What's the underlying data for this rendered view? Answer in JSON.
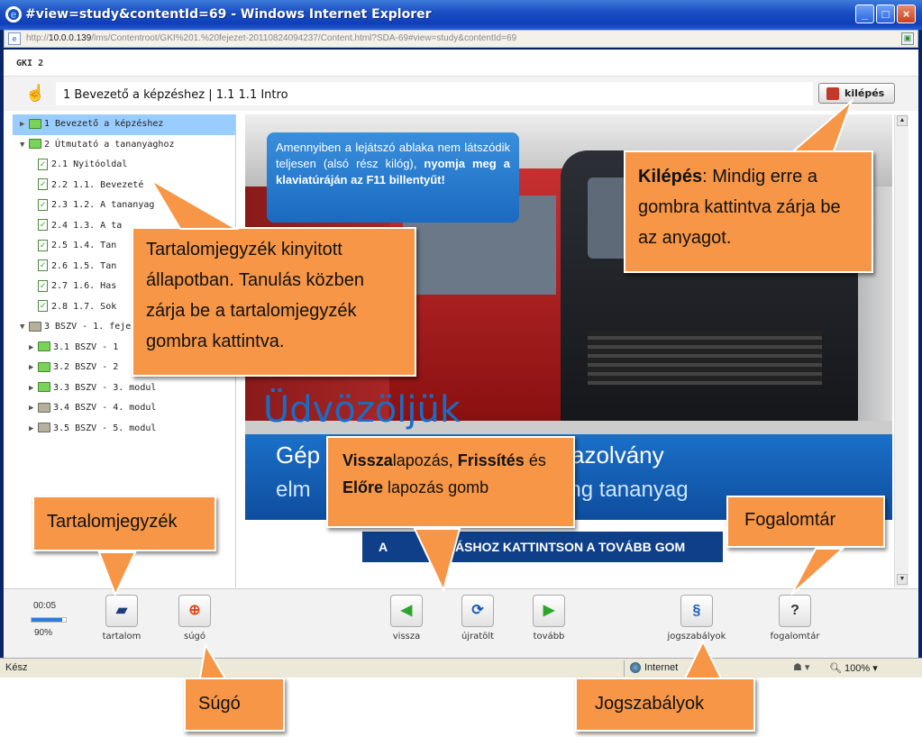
{
  "window": {
    "title": "#view=study&contentId=69 - Windows Internet Explorer",
    "url_prefix": "http://",
    "url_host": "10.0.0.139",
    "url_path": "/lms/Contentroot/GKI%201.%20fejezet-20110824094237/Content.html?SDA-69#view=study&contentId=69"
  },
  "app": {
    "name": "GKI 2",
    "breadcrumb": "1 Bevezető a képzéshez | 1.1 1.1 Intro",
    "exit_label": "kilépés"
  },
  "toc": [
    {
      "label": "1 Bevezető a képzéshez",
      "arrow": "▶",
      "type": "folder"
    },
    {
      "label": "2 Útmutató a tananyaghoz",
      "arrow": "▼",
      "type": "folder"
    },
    {
      "label": "2.1 Nyitóoldal",
      "arrow": "",
      "type": "check"
    },
    {
      "label": "2.2 1.1. Bevezeté",
      "arrow": "",
      "type": "check"
    },
    {
      "label": "2.3 1.2. A tananyag",
      "arrow": "",
      "type": "check"
    },
    {
      "label": "2.4 1.3. A ta",
      "arrow": "",
      "type": "check"
    },
    {
      "label": "2.5 1.4. Tan",
      "arrow": "",
      "type": "check"
    },
    {
      "label": "2.6 1.5. Tan",
      "arrow": "",
      "type": "check"
    },
    {
      "label": "2.7 1.6. Has",
      "arrow": "",
      "type": "check"
    },
    {
      "label": "2.8 1.7. Sok",
      "arrow": "",
      "type": "check"
    },
    {
      "label": "3 BSZV - 1. feje",
      "arrow": "▼",
      "type": "folder-gray"
    },
    {
      "label": "3.1 BSZV - 1",
      "arrow": "▶",
      "type": "folder"
    },
    {
      "label": "3.2 BSZV - 2",
      "arrow": "▶",
      "type": "folder"
    },
    {
      "label": "3.3 BSZV - 3. modul",
      "arrow": "▶",
      "type": "folder"
    },
    {
      "label": "3.4 BSZV - 4. modul",
      "arrow": "▶",
      "type": "folder-gray"
    },
    {
      "label": "3.5 BSZV - 5. modul",
      "arrow": "▶",
      "type": "folder-gray"
    }
  ],
  "slide": {
    "notice_1": "Amennyiben a lejátszó ablaka nem látszódik teljesen (alsó rész kilóg),",
    "notice_2": "nyomja meg a klaviatúráján az F11 billentyűt!",
    "welcome": "Üdvözöljük",
    "band_1": "Gép                             tési Igazolvány",
    "band_2": "elm                          ítő e-learning tananyag",
    "cta": "A               ATÁSHOZ KATTINTSON A TOVÁBB GOM"
  },
  "toolbar": {
    "time": "00:05",
    "percent": "90%",
    "progress": 0.9,
    "tartalom": "tartalom",
    "sugo": "súgó",
    "vissza": "vissza",
    "ujratolt": "újratölt",
    "tovabb": "tovább",
    "jogszabalyok": "jogszabályok",
    "fogalomtar": "fogalomtár"
  },
  "status": {
    "left": "Kész",
    "zone": "Internet",
    "zoom": "100%"
  },
  "callouts": {
    "toc": "Tartalomjegyzék kinyitott állapotban. Tanulás közben zárja be a tartalomjegyzék gombra kattintva.",
    "exit_bold": "Kilépés",
    "exit_rest": ": Mindig erre a gombra kattintva zárja be az anyagot.",
    "nav_b1": "Vissza",
    "nav_t1": "lapozás, ",
    "nav_b2": "Frissítés",
    "nav_t2": " és ",
    "nav_b3": "Előre",
    "nav_t3": " lapozás gomb",
    "tartalom": "Tartalomjegyzék",
    "fogalomtar": "Fogalomtár",
    "sugo": "Súgó",
    "jogszabalyok": "Jogszabályok"
  },
  "colors": {
    "callout": "#f79646",
    "selection": "#99ccff",
    "accent": "#1a6ac0"
  }
}
